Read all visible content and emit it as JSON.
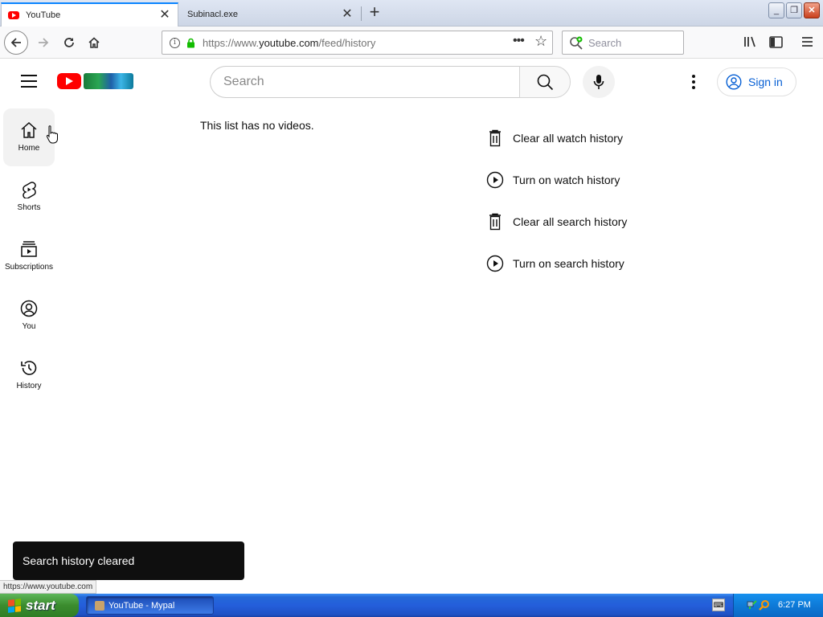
{
  "browser": {
    "tabs": [
      {
        "label": "YouTube",
        "active": true
      },
      {
        "label": "Subinacl.exe",
        "active": false
      }
    ],
    "url_prefix": "https://www.",
    "url_domain": "youtube.com",
    "url_path": "/feed/history",
    "search_placeholder": "Search",
    "status_url": "https://www.youtube.com"
  },
  "youtube": {
    "search_placeholder": "Search",
    "signin_label": "Sign in",
    "guide": [
      {
        "label": "Home",
        "icon": "home-icon"
      },
      {
        "label": "Shorts",
        "icon": "shorts-icon"
      },
      {
        "label": "Subscriptions",
        "icon": "subscriptions-icon"
      },
      {
        "label": "You",
        "icon": "you-icon"
      },
      {
        "label": "History",
        "icon": "history-icon"
      }
    ],
    "empty_message": "This list has no videos.",
    "actions": [
      {
        "label": "Clear all watch history",
        "icon": "trash-icon"
      },
      {
        "label": "Turn on watch history",
        "icon": "play-circle-icon"
      },
      {
        "label": "Clear all search history",
        "icon": "trash-icon"
      },
      {
        "label": "Turn on search history",
        "icon": "play-circle-icon"
      }
    ],
    "toast": "Search history cleared"
  },
  "taskbar": {
    "start_label": "start",
    "task_label": "YouTube - Mypal",
    "ime_label": "⌨",
    "clock": "6:27 PM"
  },
  "colors": {
    "accent": "#0a84ff",
    "youtube_red": "#ff0000",
    "signin_blue": "#065fd4",
    "taskbar_blue": "#245edb",
    "start_green": "#3b8c2e"
  }
}
